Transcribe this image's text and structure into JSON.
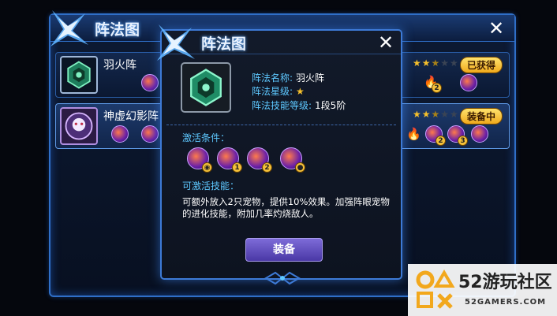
{
  "background_window": {
    "title": "阵法图",
    "close_glyph": "✕",
    "rows": [
      {
        "name": "羽火阵",
        "badge": "已获得",
        "stars": 2.5,
        "max_stars": 5,
        "icon": "green-hex-formation-icon"
      },
      {
        "name": "神虚幻影阵",
        "badge": "装备中",
        "stars": 2.5,
        "max_stars": 5,
        "icon": "purple-ghost-formation-icon"
      }
    ],
    "row1_icon_subs": [
      "2"
    ],
    "row2_icon_subs": [
      "2",
      "3"
    ]
  },
  "popup": {
    "title": "阵法图",
    "close_glyph": "✕",
    "name_label": "阵法名称:",
    "name_value": "羽火阵",
    "star_label": "阵法星级:",
    "star_count": 0.5,
    "level_label": "阵法技能等级:",
    "level_value": "1段5阶",
    "condition_label": "激活条件：",
    "conditions": [
      {
        "icon": "eye-badge-icon",
        "badge": ""
      },
      {
        "icon": "fire-badge-icon",
        "badge": "1"
      },
      {
        "icon": "swirl-badge-icon",
        "badge": "2"
      },
      {
        "icon": "person-badge-icon",
        "badge": ""
      }
    ],
    "skill_label": "可激活技能：",
    "skill_text": "可额外放入2只宠物，提供10%效果。加强阵眼宠物的进化技能，附加几率灼烧敌人。",
    "equip_button": "装备"
  },
  "watermark": {
    "brand": "52游玩社区",
    "url": "52GAMERS.COM"
  },
  "colors": {
    "accent_blue": "#3d7ad6",
    "label_cyan": "#5ec8ff",
    "badge_gold": "#f0a91c",
    "button_purple": "#5c4ac0"
  }
}
